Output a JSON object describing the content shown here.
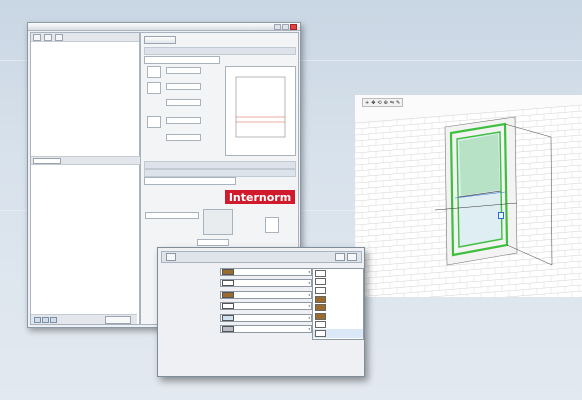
{
  "colors": {
    "brand_red": "#d11b2d",
    "brass": "#9a6b2c",
    "white_ral": "#ffffff",
    "glass": "#cfe3ee",
    "alu": "#b9bec4",
    "frame_green": "#3fbf3f"
  },
  "dialog": {
    "title": "",
    "library": {
      "tree": [],
      "thumbs": [],
      "footer_button": ""
    },
    "panel": {
      "top_button": "",
      "top_link": "",
      "brand": "Internorm",
      "rows_left": [],
      "rows_right": [],
      "bottom_buttons": []
    }
  },
  "render": {
    "tooltip": ""
  },
  "material": {
    "title": "",
    "rows": [
      {
        "label": "",
        "value": "",
        "swatch": "#9a6b2c"
      },
      {
        "label": "",
        "value": "",
        "swatch": "#ffffff"
      },
      {
        "label": "",
        "value": "",
        "swatch": "#9a6b2c"
      },
      {
        "label": "",
        "value": "",
        "swatch": "#ffffff"
      },
      {
        "label": "",
        "value": "",
        "swatch": "#cfe3ee"
      },
      {
        "label": "",
        "value": "",
        "swatch": "#b9bec4"
      }
    ],
    "options": [
      {
        "label": "",
        "swatch": "#ffffff"
      },
      {
        "label": "",
        "swatch": "#ffffff"
      },
      {
        "label": "",
        "swatch": "#ffffff"
      },
      {
        "label": "",
        "swatch": "#9a6b2c"
      },
      {
        "label": "",
        "swatch": "#9a6b2c"
      },
      {
        "label": "",
        "swatch": "#9a6b2c"
      },
      {
        "label": "",
        "swatch": "#ffffff"
      },
      {
        "label": "",
        "swatch": "#ffffff"
      }
    ]
  }
}
